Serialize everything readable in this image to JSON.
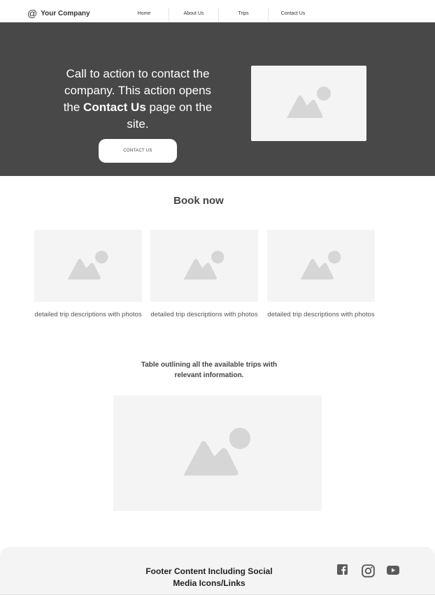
{
  "header": {
    "brand_icon": "at-sign-icon",
    "brand_symbol": "@",
    "brand_name": "Your Company",
    "nav": [
      "Home",
      "About Us",
      "Trips",
      "Contact Us"
    ]
  },
  "hero": {
    "text_before": "Call to action to contact the company. This action opens the ",
    "text_bold": "Contact Us",
    "text_after": " page on the site.",
    "button_label": "CONTACT US",
    "image_icon": "image-placeholder-icon"
  },
  "book": {
    "title": "Book now",
    "trips": [
      {
        "description": "detailed trip descriptions with photos",
        "image_icon": "image-placeholder-icon"
      },
      {
        "description": "detailed trip descriptions with photos",
        "image_icon": "image-placeholder-icon"
      },
      {
        "description": "detailed trip descriptions with photos",
        "image_icon": "image-placeholder-icon"
      }
    ],
    "table_note": "Table outlining all the available trips with relevant information."
  },
  "footer": {
    "text": "Footer Content Including Social Media Icons/Links",
    "social_icons": [
      "facebook-icon",
      "instagram-icon",
      "youtube-icon"
    ]
  },
  "colors": {
    "hero_bg": "#484848",
    "placeholder_bg": "#f4f4f4",
    "placeholder_shape": "#d6d6d6",
    "footer_bg": "#f4f4f4"
  }
}
